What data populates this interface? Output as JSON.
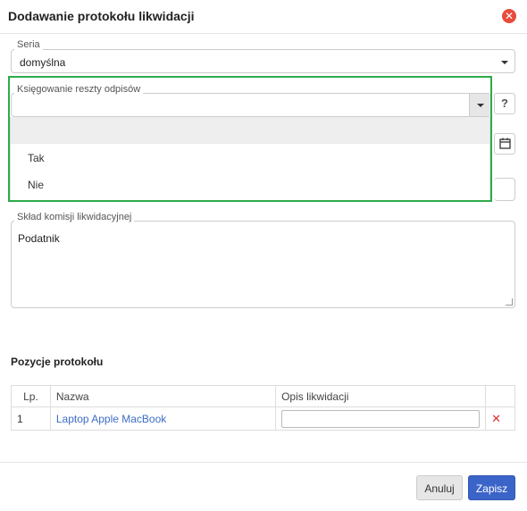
{
  "dialog": {
    "title": "Dodawanie protokołu likwidacji",
    "close_icon": "close-circle-icon"
  },
  "seria": {
    "label": "Seria",
    "value": "domyślna"
  },
  "ksiegowanie": {
    "label": "Księgowanie reszty odpisów",
    "value": "",
    "options": [
      "",
      "Tak",
      "Nie"
    ],
    "help_label": "?"
  },
  "sklad": {
    "label": "Skład komisji likwidacyjnej",
    "value": "Podatnik"
  },
  "positions": {
    "section_title": "Pozycje protokołu",
    "columns": [
      "Lp.",
      "Nazwa",
      "Opis likwidacji",
      ""
    ],
    "rows": [
      {
        "lp": "1",
        "nazwa": "Laptop Apple MacBook",
        "opis": ""
      }
    ]
  },
  "footer": {
    "cancel_label": "Anuluj",
    "save_label": "Zapisz"
  },
  "colors": {
    "highlight": "#2eab4b",
    "primary": "#3b64c9",
    "danger": "#e0302e"
  }
}
